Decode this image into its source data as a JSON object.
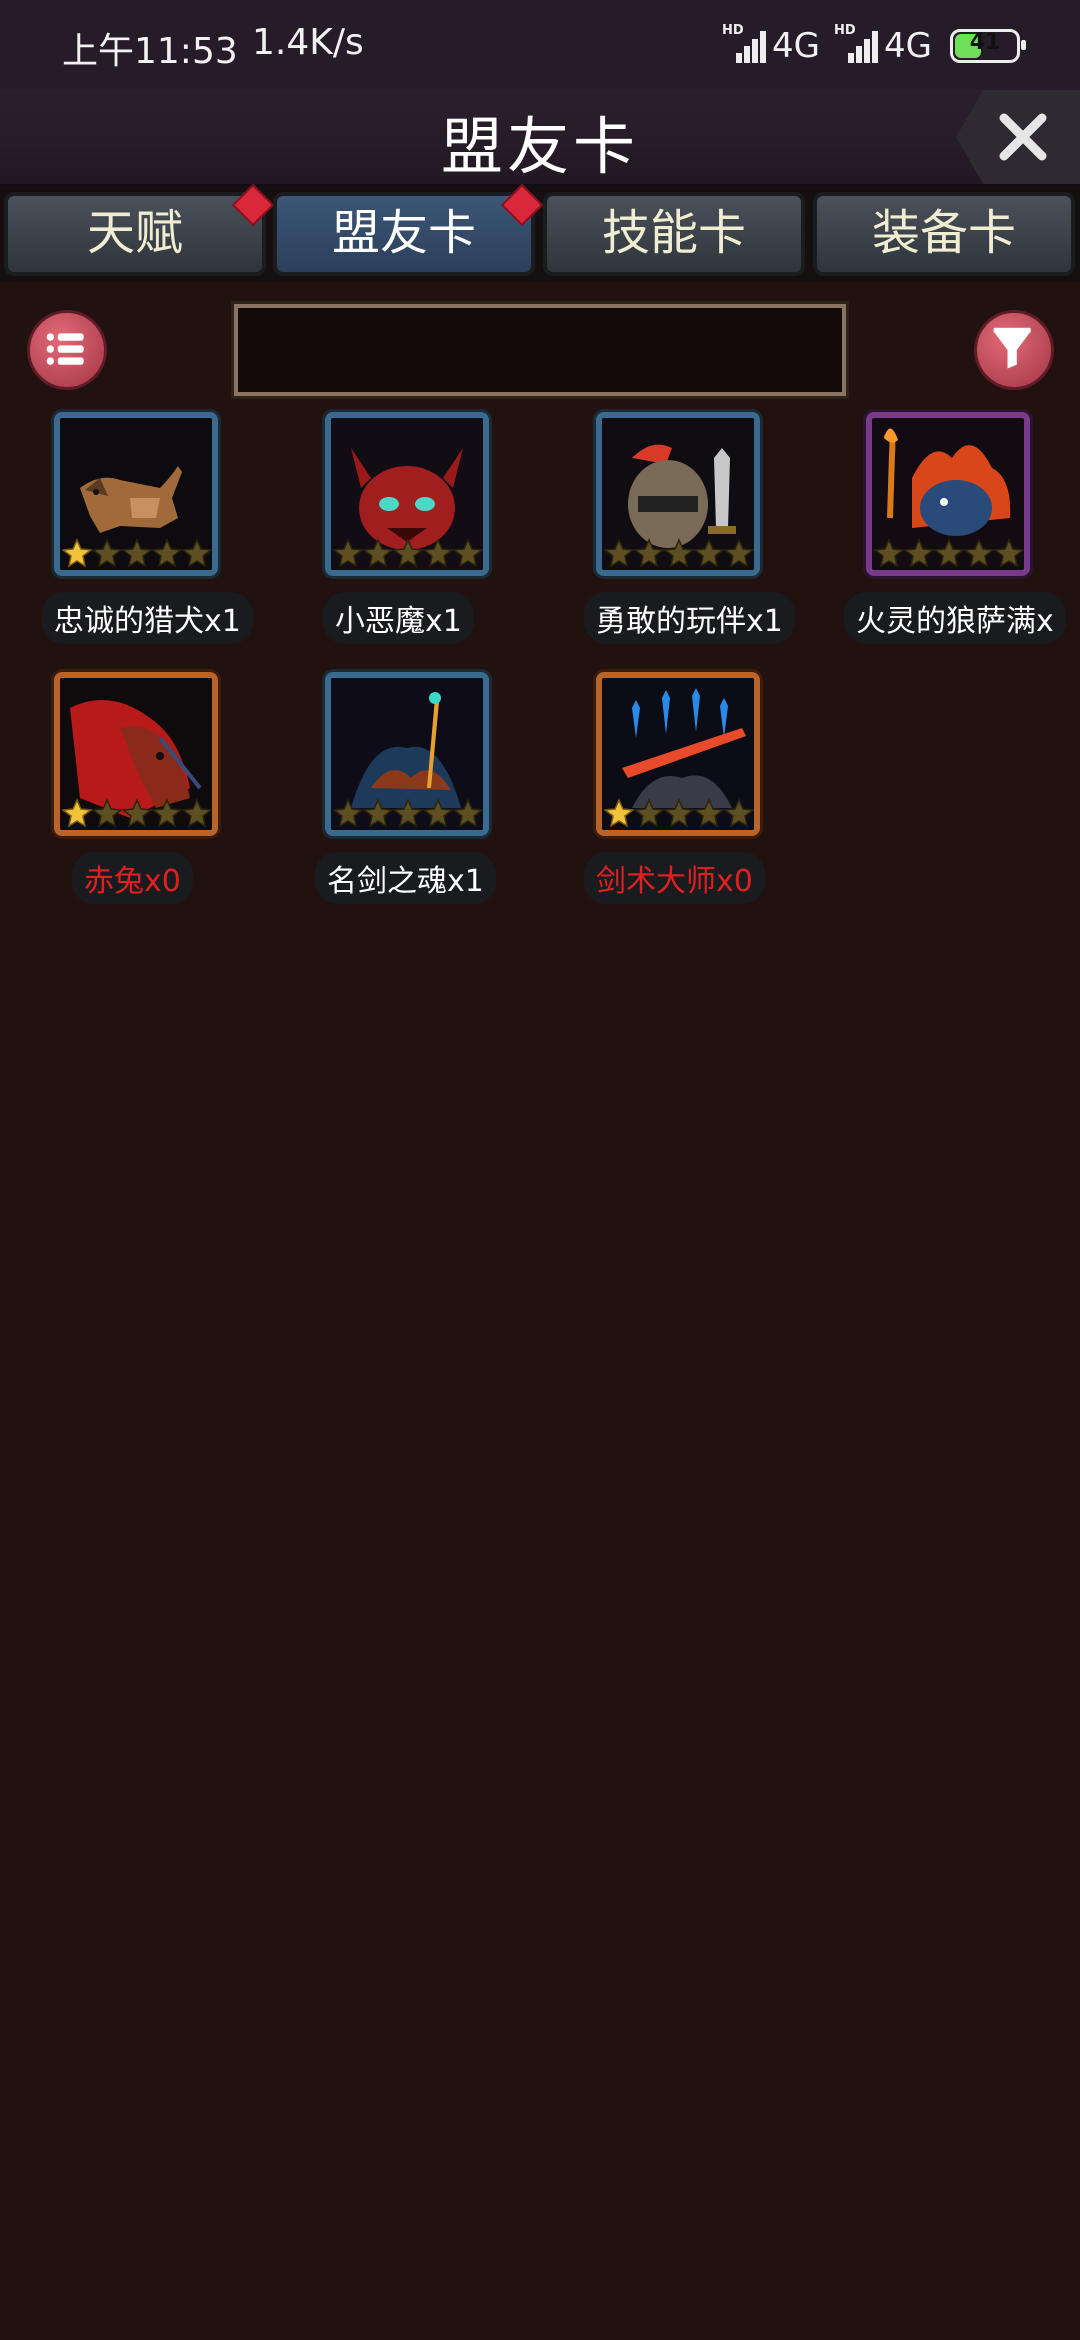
{
  "status_bar": {
    "time": "上午11:53",
    "speed": "1.4K/s",
    "net1": "4G",
    "net2": "4G",
    "battery": "41"
  },
  "header": {
    "title": "盟友卡"
  },
  "tabs": [
    {
      "label": "天赋",
      "badge": true
    },
    {
      "label": "盟友卡",
      "badge": true,
      "active": true
    },
    {
      "label": "技能卡",
      "badge": false
    },
    {
      "label": "装备卡",
      "badge": false
    }
  ],
  "search": {
    "value": ""
  },
  "cards": [
    {
      "name": "忠诚的猎犬x1",
      "stars_filled": 1,
      "owned": true,
      "frame": "blue"
    },
    {
      "name": "小恶魔x1",
      "stars_filled": 0,
      "owned": true,
      "frame": "blue"
    },
    {
      "name": "勇敢的玩伴x1",
      "stars_filled": 0,
      "owned": true,
      "frame": "blue"
    },
    {
      "name": "火灵的狼萨满x",
      "stars_filled": 0,
      "owned": true,
      "frame": "purple"
    },
    {
      "name": "赤兔x0",
      "stars_filled": 1,
      "owned": false,
      "frame": "orange"
    },
    {
      "name": "名剑之魂x1",
      "stars_filled": 0,
      "owned": true,
      "frame": "blue"
    },
    {
      "name": "剑术大师x0",
      "stars_filled": 1,
      "owned": false,
      "frame": "orange"
    }
  ],
  "colors": {
    "background": "#21110f",
    "missing_text": "#e02020",
    "star_filled": "#f2c23a",
    "star_empty": "#5d4f22"
  }
}
